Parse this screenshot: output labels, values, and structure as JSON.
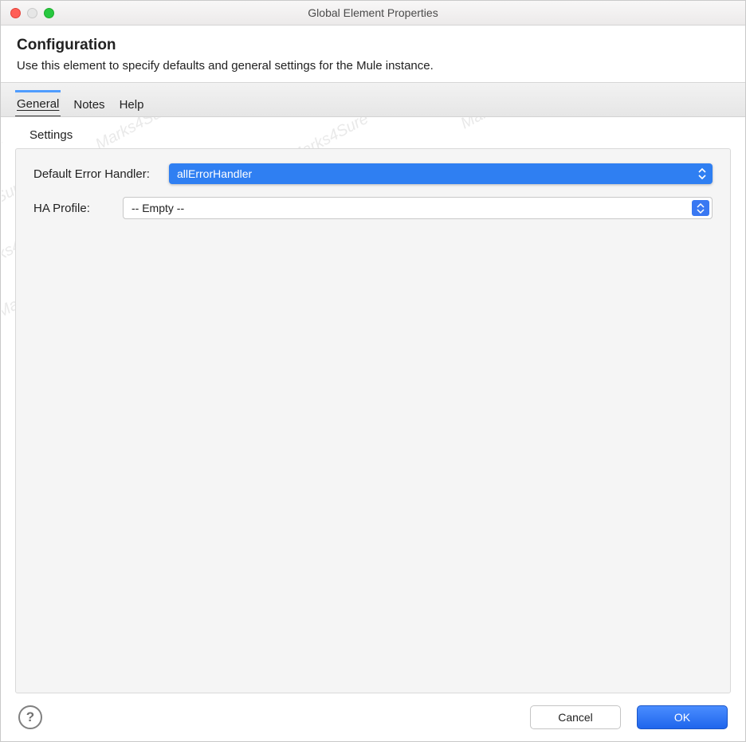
{
  "window": {
    "title": "Global Element Properties"
  },
  "header": {
    "title": "Configuration",
    "description": "Use this element to specify defaults and general settings for the Mule instance."
  },
  "tabs": [
    {
      "label": "General",
      "active": true
    },
    {
      "label": "Notes",
      "active": false
    },
    {
      "label": "Help",
      "active": false
    }
  ],
  "settings": {
    "group_label": "Settings",
    "rows": {
      "default_error_handler": {
        "label": "Default Error Handler:",
        "value": "allErrorHandler"
      },
      "ha_profile": {
        "label": "HA Profile:",
        "value": "-- Empty --"
      }
    }
  },
  "footer": {
    "cancel": "Cancel",
    "ok": "OK"
  },
  "help_glyph": "?"
}
